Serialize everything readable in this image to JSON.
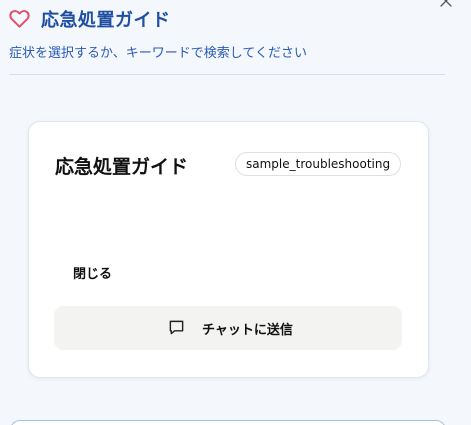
{
  "header": {
    "title": "応急処置ガイド",
    "subtitle": "症状を選択するか、キーワードで検索してください",
    "heart_icon": "heart-icon",
    "close_icon": "close-icon"
  },
  "card": {
    "title": "応急処置ガイド",
    "tag": "sample_troubleshooting",
    "close_label": "閉じる",
    "chat_button": {
      "icon": "chat-icon",
      "label": "チャットに送信"
    }
  },
  "colors": {
    "accent": "#1f4fa3",
    "subtitle": "#2a5bb5",
    "heart": "#e0506a",
    "background": "#f4f7fb",
    "card": "#ffffff",
    "button": "#f3f3f2"
  }
}
